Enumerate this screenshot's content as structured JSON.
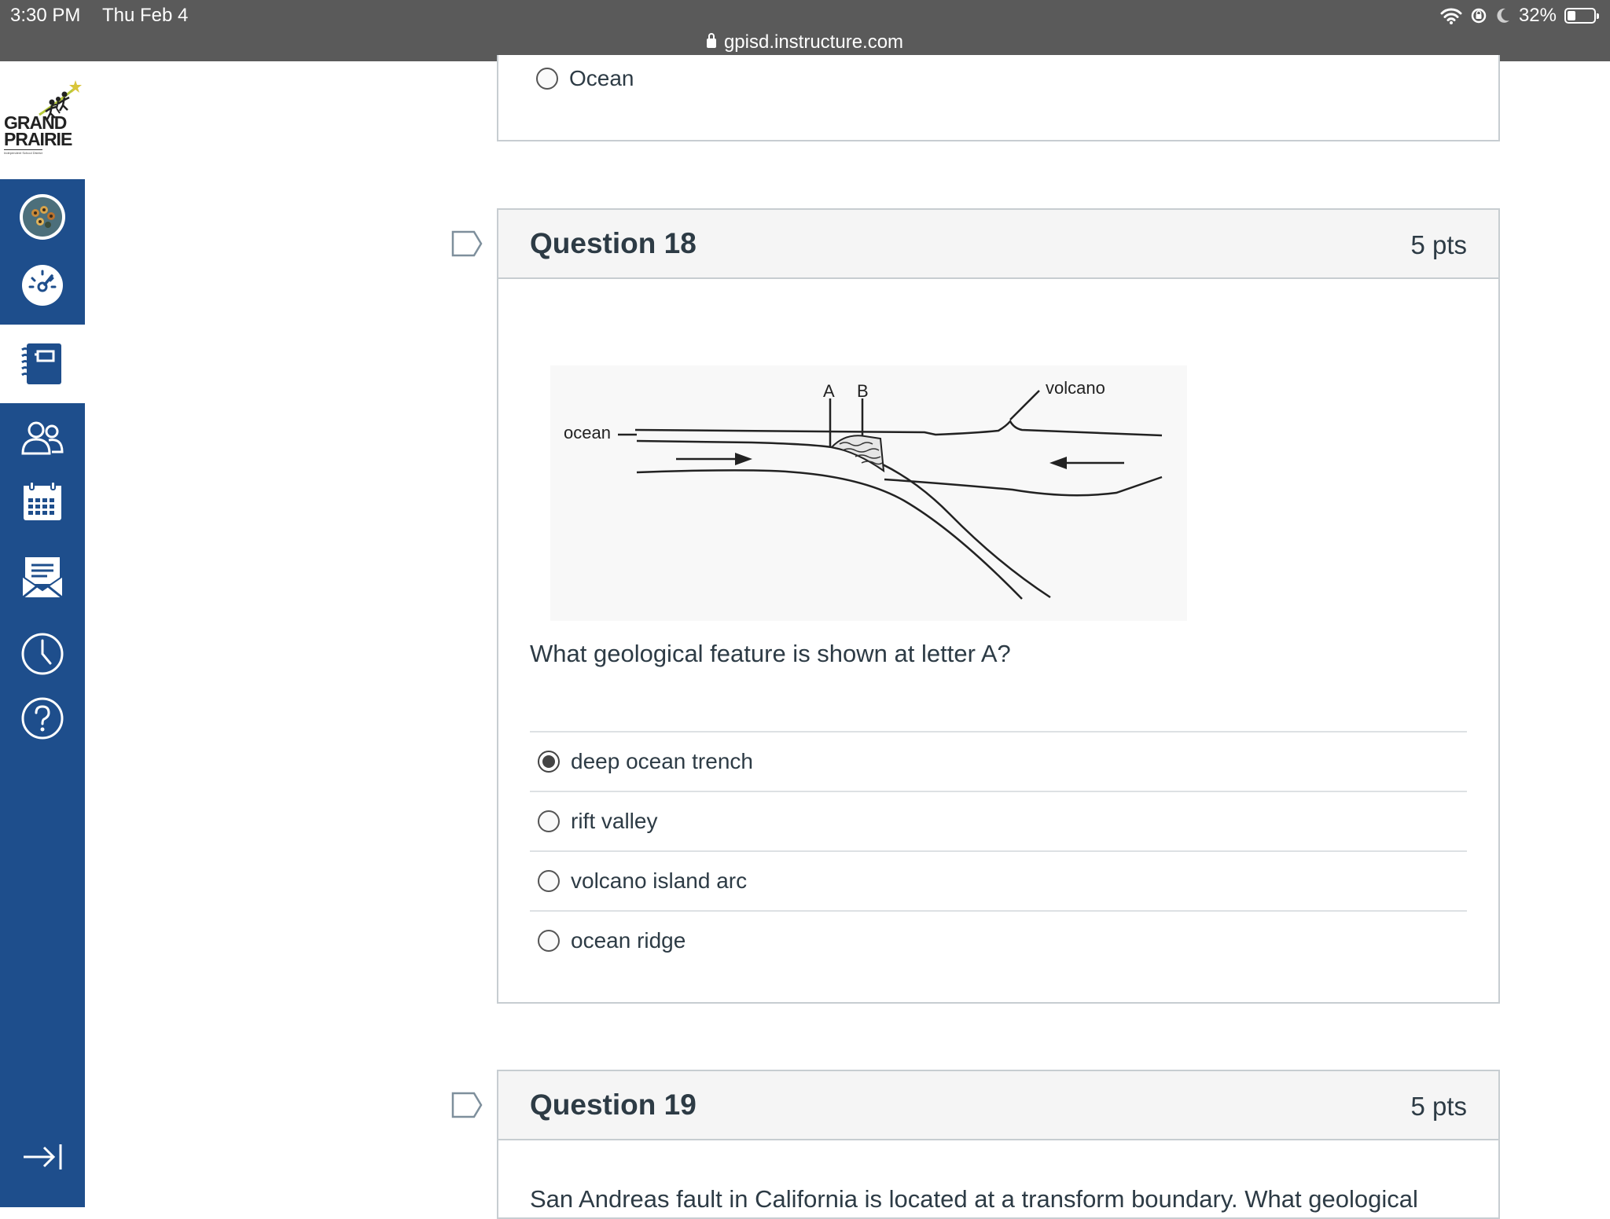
{
  "status_bar": {
    "time": "3:30 PM",
    "date": "Thu Feb 4",
    "url": "gpisd.instructure.com",
    "battery": "32%",
    "battery_level": 0.32
  },
  "logo": {
    "line1": "GRAND",
    "line2": "PRAIRIE",
    "line3": "Independent School District"
  },
  "nav": {
    "items": [
      {
        "name": "account",
        "icon": "avatar-icon"
      },
      {
        "name": "dashboard",
        "icon": "dashboard-icon"
      },
      {
        "name": "courses",
        "icon": "courses-icon",
        "active": true
      },
      {
        "name": "groups",
        "icon": "groups-icon"
      },
      {
        "name": "calendar",
        "icon": "calendar-icon"
      },
      {
        "name": "inbox",
        "icon": "inbox-icon"
      },
      {
        "name": "history",
        "icon": "clock-icon"
      },
      {
        "name": "help",
        "icon": "help-icon"
      },
      {
        "name": "collapse",
        "icon": "collapse-arrow-icon"
      }
    ]
  },
  "prev_question": {
    "last_answer": "Ocean"
  },
  "question18": {
    "title": "Question 18",
    "points": "5 pts",
    "figure": {
      "label_ocean": "ocean",
      "label_a": "A",
      "label_b": "B",
      "label_volcano": "volcano"
    },
    "text": "What geological feature is shown at letter A?",
    "answers": [
      {
        "label": "deep ocean trench",
        "selected": true
      },
      {
        "label": "rift valley",
        "selected": false
      },
      {
        "label": "volcano island arc",
        "selected": false
      },
      {
        "label": "ocean ridge",
        "selected": false
      }
    ]
  },
  "question19": {
    "title": "Question 19",
    "points": "5 pts",
    "text_partial": "San Andreas fault in California is located at a transform boundary. What geological"
  },
  "colors": {
    "nav_bg": "#1e4e8c",
    "status_bg": "#5a5a5a",
    "card_header_bg": "#f5f5f5",
    "border": "#c7cdd1"
  }
}
